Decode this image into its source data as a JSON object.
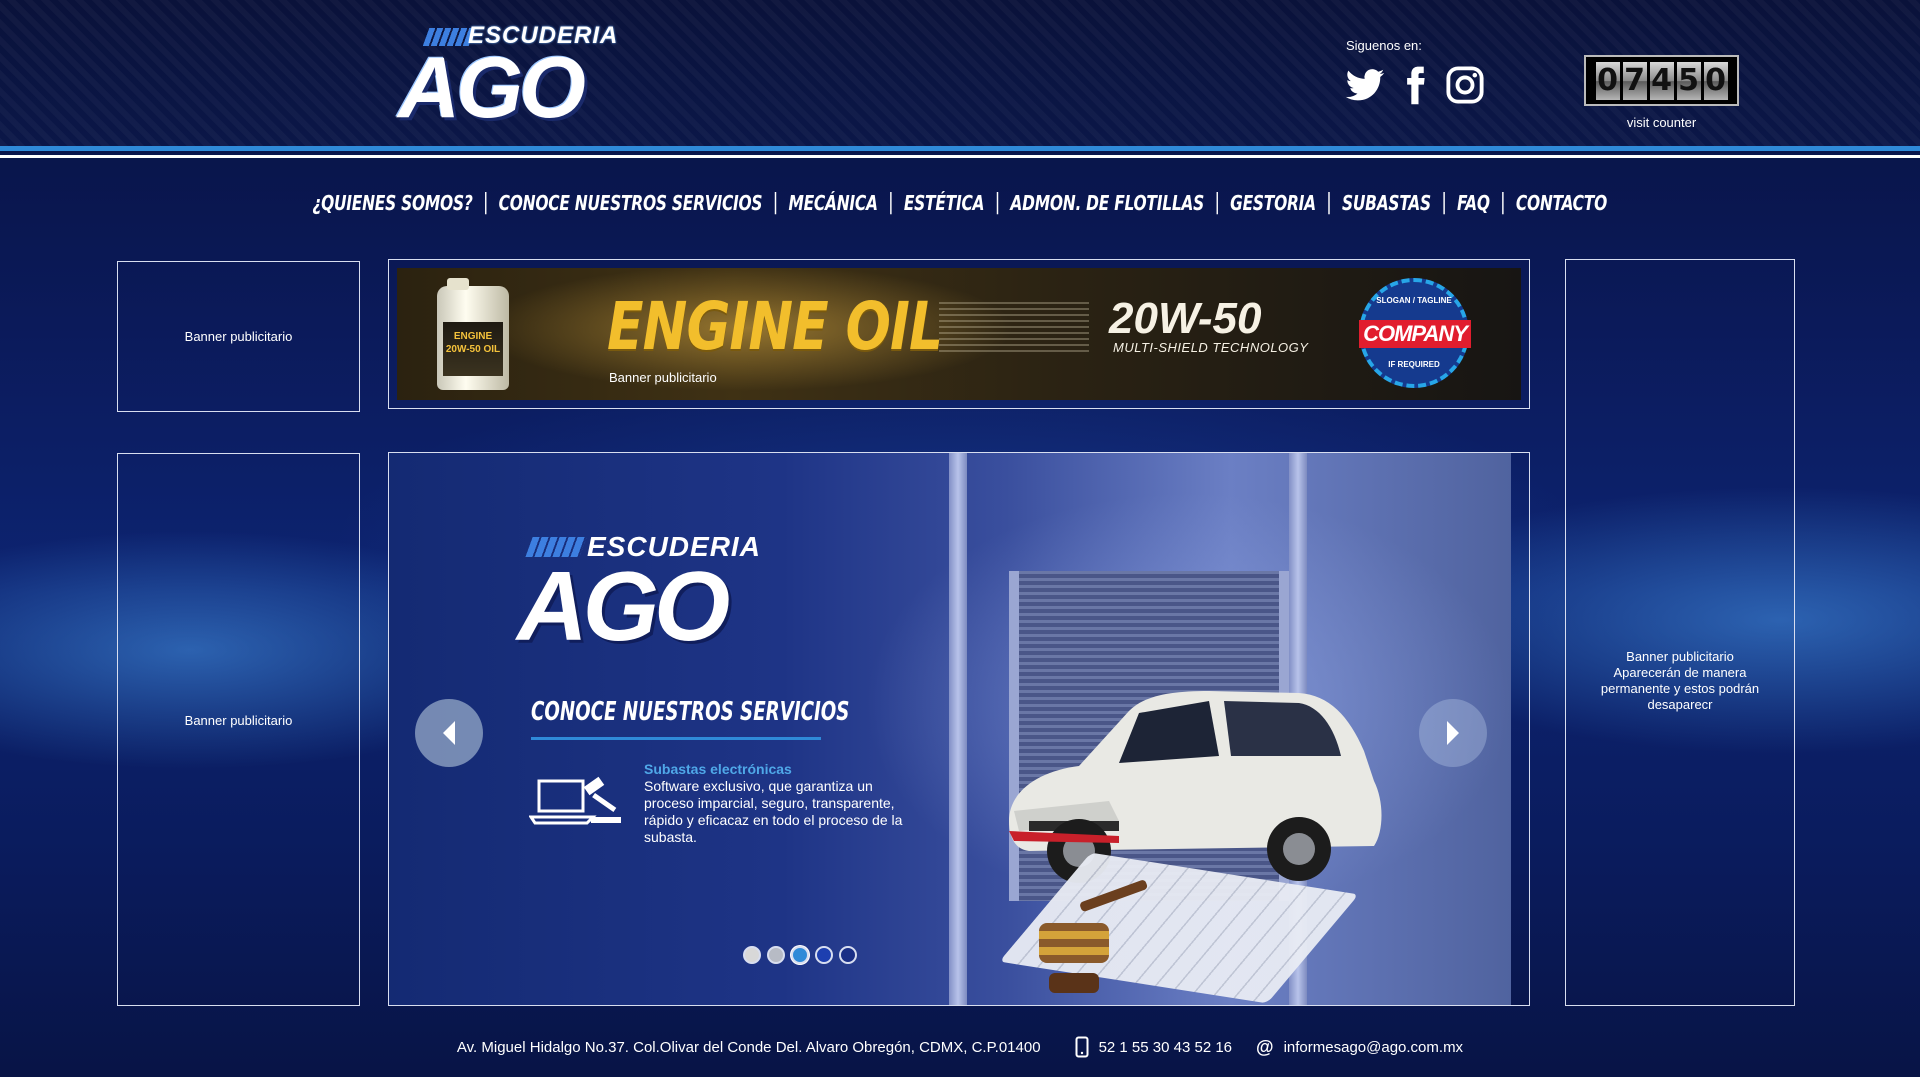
{
  "header": {
    "logo": {
      "top": "ESCUDERIA",
      "main": "AGO"
    },
    "social_label": "Siguenos en:",
    "social": [
      {
        "name": "twitter-icon"
      },
      {
        "name": "facebook-icon"
      },
      {
        "name": "instagram-icon"
      }
    ],
    "counter": {
      "digits": [
        "0",
        "7",
        "4",
        "5",
        "0"
      ],
      "label": "visit counter"
    }
  },
  "nav": {
    "items": [
      "¿QUIENES SOMOS?",
      "CONOCE NUESTROS SERVICIOS",
      "MECÁNICA",
      "ESTÉTICA",
      "ADMON. DE FLOTILLAS",
      "GESTORIA",
      "SUBASTAS",
      "FAQ",
      "CONTACTO"
    ],
    "separator": "|"
  },
  "banners": {
    "left_top": "Banner publicitario",
    "left_bottom": "Banner publicitario",
    "right_line1": "Banner publicitario",
    "right_line2": "Aparecerán de manera permanente y estos podrán desaparecr",
    "top": {
      "label": "Banner publicitario",
      "title": "ENGINE OIL",
      "grade": "20W-50",
      "tech": "MULTI-SHIELD TECHNOLOGY",
      "jug_label_line1": "ENGINE",
      "jug_label_line2": "20W-50 OIL",
      "badge_top": "SLOGAN / TAGLINE",
      "badge_main": "COMPANY",
      "badge_bottom": "IF REQUIRED"
    }
  },
  "slider": {
    "logo": {
      "top": "ESCUDERIA",
      "main": "AGO"
    },
    "heading": "CONOCE NUESTROS SERVICIOS",
    "subtitle": "Subastas electrónicas",
    "description": "Software exclusivo, que garantiza un proceso imparcial, seguro, transparente, rápido y eficacaz en todo el proceso de la subasta.",
    "dots": [
      {
        "color": "#d8d8d8"
      },
      {
        "color": "#b7bbc5"
      },
      {
        "color": "#2f8ad8"
      },
      {
        "color": "#1d3fb0"
      },
      {
        "color": "#1a2f86"
      }
    ],
    "active_dot": 3
  },
  "footer": {
    "address": "Av. Miguel Hidalgo No.37. Col.Olivar del Conde Del. Alvaro Obregón, CDMX, C.P.01400",
    "phone": "52 1 55 30 43 52 16",
    "email": "informesago@ago.com.mx"
  },
  "colors": {
    "accent": "#2f8ad8",
    "background_dark": "#07113e",
    "banner_gold": "#f2be2c"
  }
}
